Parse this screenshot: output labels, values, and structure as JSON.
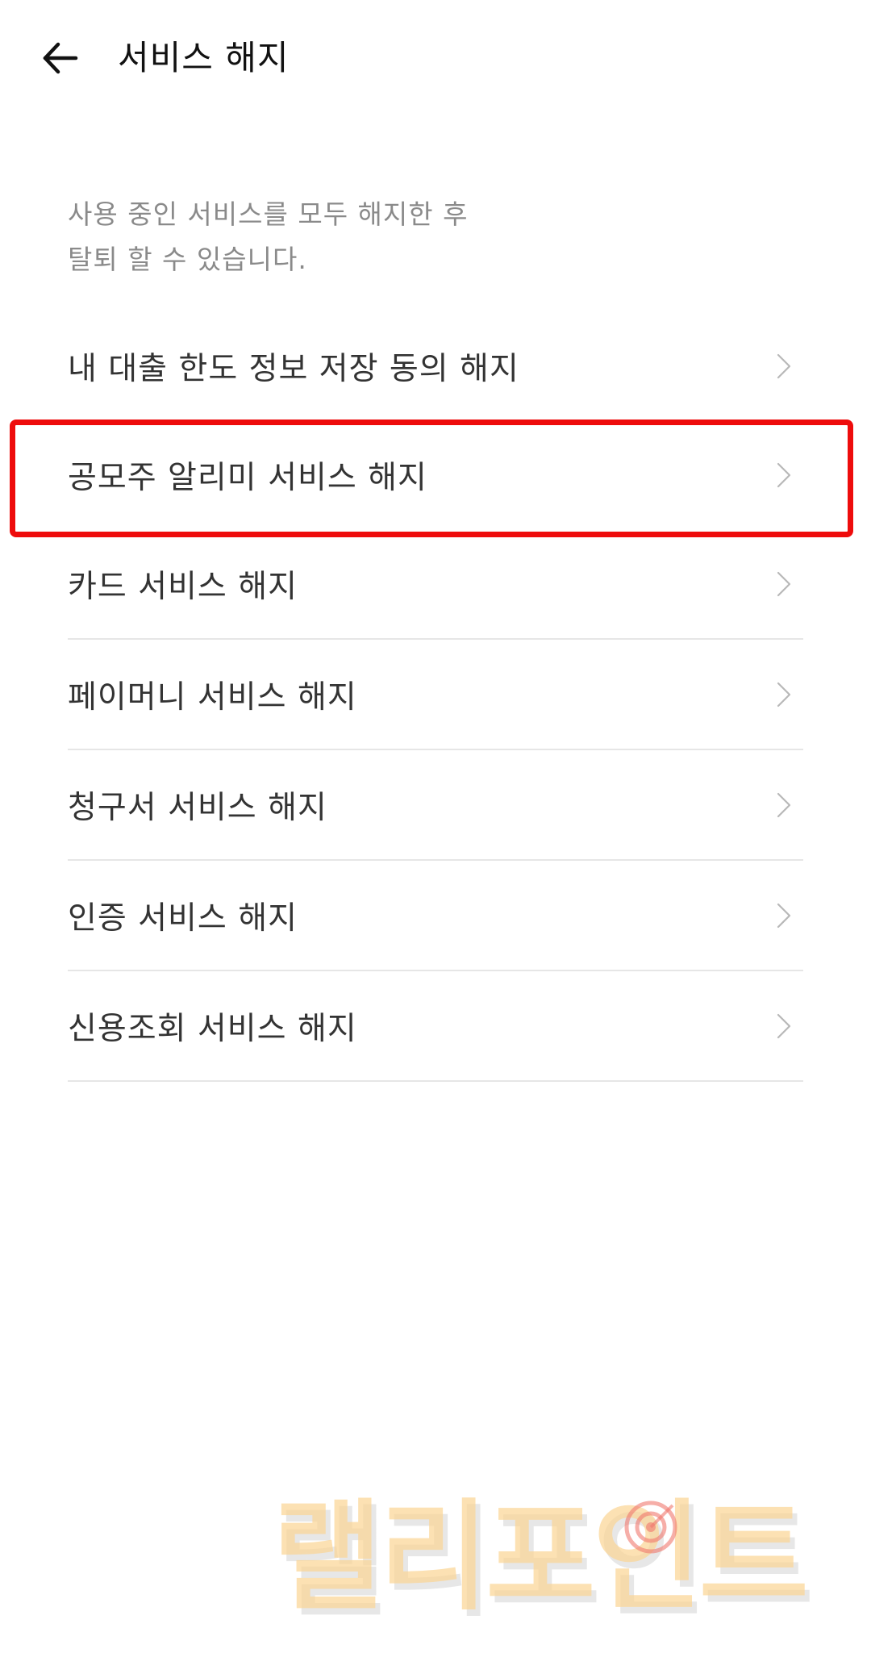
{
  "header": {
    "title": "서비스 해지",
    "back_icon": "arrow-left-icon"
  },
  "description": {
    "line1": "사용 중인 서비스를 모두 해지한 후",
    "line2": "탈퇴 할 수 있습니다."
  },
  "menu": {
    "items": [
      {
        "label": "내 대출 한도 정보 저장 동의 해지",
        "icon": "chevron-right-icon"
      },
      {
        "label": "공모주 알리미 서비스 해지",
        "icon": "chevron-right-icon",
        "highlighted": true
      },
      {
        "label": "카드 서비스 해지",
        "icon": "chevron-right-icon"
      },
      {
        "label": "페이머니 서비스 해지",
        "icon": "chevron-right-icon"
      },
      {
        "label": "청구서 서비스 해지",
        "icon": "chevron-right-icon"
      },
      {
        "label": "인증 서비스 해지",
        "icon": "chevron-right-icon"
      },
      {
        "label": "신용조회 서비스 해지",
        "icon": "chevron-right-icon"
      }
    ]
  },
  "watermark": {
    "text": "랠리포인트"
  },
  "colors": {
    "highlight_border": "#ee0c0c",
    "description_text": "#8a8a8a",
    "divider": "#e6e6e6",
    "watermark": "#fbd696"
  }
}
